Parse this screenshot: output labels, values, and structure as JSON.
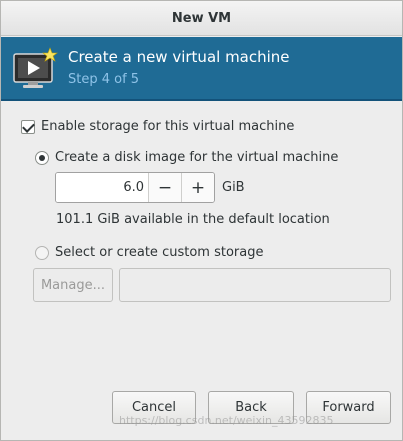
{
  "window": {
    "title": "New VM"
  },
  "banner": {
    "title": "Create a new virtual machine",
    "step": "Step 4 of 5",
    "icon": "vm-monitor-icon",
    "bg_color": "#1f6b95"
  },
  "storage": {
    "enable_label": "Enable storage for this virtual machine",
    "enable_checked": true,
    "disk_option_label": "Create a disk image for the virtual machine",
    "disk_option_selected": true,
    "disk_size_value": "6.0",
    "decrement_label": "−",
    "increment_label": "+",
    "unit": "GiB",
    "available_text": "101.1 GiB available in the default location",
    "custom_option_label": "Select or create custom storage",
    "custom_option_selected": false,
    "manage_button_label": "Manage...",
    "custom_path_value": ""
  },
  "footer": {
    "cancel_label": "Cancel",
    "back_label": "Back",
    "forward_label": "Forward"
  },
  "watermark": {
    "text": "https://blog.csdn.net/weixin_43592835"
  }
}
